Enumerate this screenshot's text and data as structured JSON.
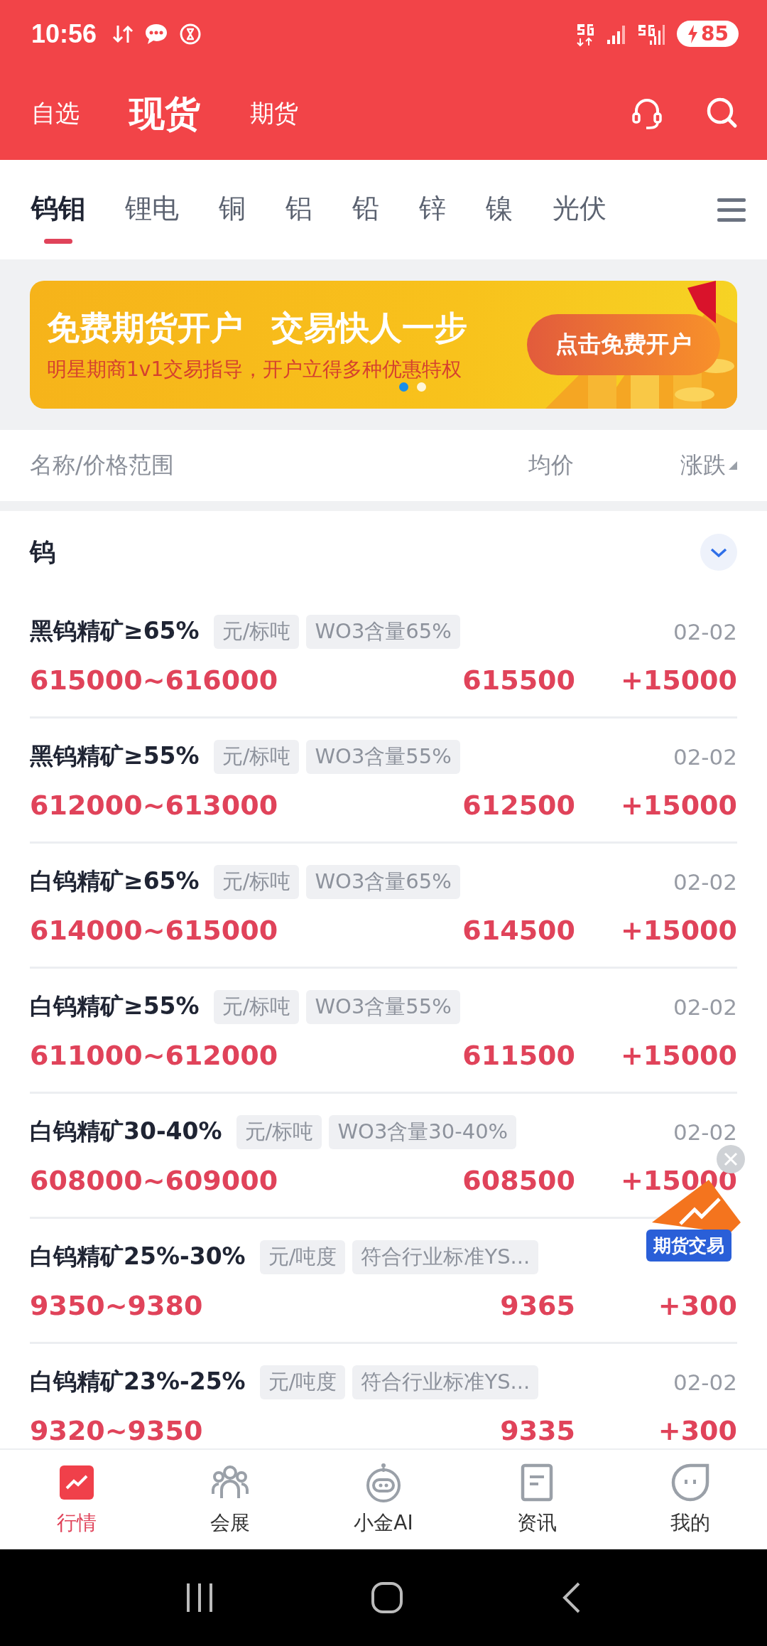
{
  "status_bar": {
    "time": "10:56",
    "battery": "85"
  },
  "top_tabs": [
    {
      "label": "自选",
      "selected": false
    },
    {
      "label": "现货",
      "selected": true
    },
    {
      "label": "期货",
      "selected": false
    }
  ],
  "category_tabs": [
    {
      "label": "钨钼",
      "selected": true
    },
    {
      "label": "锂电",
      "selected": false
    },
    {
      "label": "铜",
      "selected": false
    },
    {
      "label": "铝",
      "selected": false
    },
    {
      "label": "铅",
      "selected": false
    },
    {
      "label": "锌",
      "selected": false
    },
    {
      "label": "镍",
      "selected": false
    },
    {
      "label": "光伏",
      "selected": false
    }
  ],
  "banner": {
    "headline_1": "免费期货开户",
    "headline_2": "交易快人一步",
    "subtitle": "明星期商1v1交易指导，开户立得多种优惠特权",
    "button": "点击免费开户",
    "dots": [
      {
        "selected": true
      },
      {
        "selected": false
      }
    ]
  },
  "columns": [
    "名称/价格范围",
    "均价",
    "涨跌"
  ],
  "section": {
    "title": "钨"
  },
  "rows": [
    {
      "name": "黑钨精矿≥65%",
      "unit": "元/标吨",
      "note": "WO3含量65%",
      "date": "02-02",
      "range": "615000~616000",
      "avg": "615500",
      "change": "+15000"
    },
    {
      "name": "黑钨精矿≥55%",
      "unit": "元/标吨",
      "note": "WO3含量55%",
      "date": "02-02",
      "range": "612000~613000",
      "avg": "612500",
      "change": "+15000"
    },
    {
      "name": "白钨精矿≥65%",
      "unit": "元/标吨",
      "note": "WO3含量65%",
      "date": "02-02",
      "range": "614000~615000",
      "avg": "614500",
      "change": "+15000"
    },
    {
      "name": "白钨精矿≥55%",
      "unit": "元/标吨",
      "note": "WO3含量55%",
      "date": "02-02",
      "range": "611000~612000",
      "avg": "611500",
      "change": "+15000"
    },
    {
      "name": "白钨精矿30-40%",
      "unit": "元/标吨",
      "note": "WO3含量30-40%",
      "date": "02-02",
      "range": "608000~609000",
      "avg": "608500",
      "change": "+15000"
    },
    {
      "name": "白钨精矿25%-30%",
      "unit": "元/吨度",
      "note": "符合行业标准YS...",
      "range": "9350~9380",
      "avg": "9365",
      "change": "+300"
    },
    {
      "name": "白钨精矿23%-25%",
      "unit": "元/吨度",
      "note": "符合行业标准YS...",
      "date": "02-02",
      "range": "9320~9350",
      "avg": "9335",
      "change": "+300"
    }
  ],
  "float_badge": {
    "label": "期货交易"
  },
  "bottom_nav": [
    {
      "label": "行情",
      "kind": "chart",
      "selected": true
    },
    {
      "label": "会展",
      "kind": "people",
      "selected": false
    },
    {
      "label": "小金AI",
      "kind": "robot",
      "selected": false
    },
    {
      "label": "资讯",
      "kind": "doc",
      "selected": false
    },
    {
      "label": "我的",
      "kind": "face",
      "selected": false
    }
  ]
}
